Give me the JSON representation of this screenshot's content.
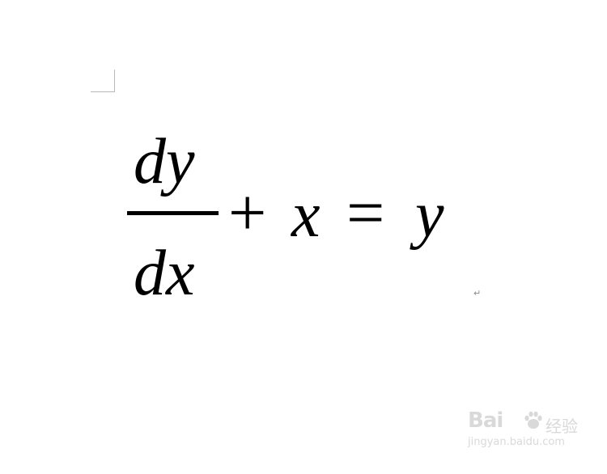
{
  "equation": {
    "numerator": "dy",
    "denominator": "dx",
    "plus": "+",
    "x_var": "x",
    "equals": "=",
    "y_var": "y"
  },
  "paragraph_mark": "↵",
  "watermark": {
    "brand": "Bai",
    "suffix": "经验",
    "url": "jingyan.baidu.com"
  }
}
